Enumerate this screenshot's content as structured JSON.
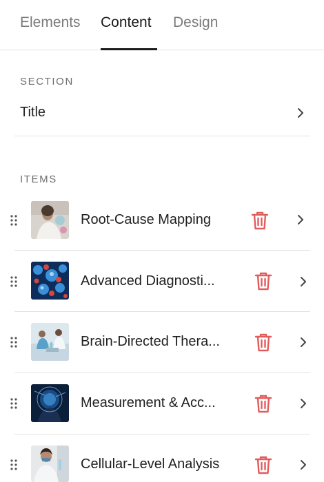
{
  "tabs": [
    {
      "label": "Elements",
      "active": false
    },
    {
      "label": "Content",
      "active": true
    },
    {
      "label": "Design",
      "active": false
    }
  ],
  "section": {
    "heading": "SECTION",
    "title_label": "Title"
  },
  "items_section": {
    "heading": "ITEMS",
    "items": [
      {
        "label": "Root-Cause Mapping",
        "thumbnail": "scientist-holding-petri-dish"
      },
      {
        "label": "Advanced Diagnosti...",
        "thumbnail": "blue-red-molecules"
      },
      {
        "label": "Brain-Directed Thera...",
        "thumbnail": "lab-researchers"
      },
      {
        "label": "Measurement & Acc...",
        "thumbnail": "digital-brain-interface"
      },
      {
        "label": "Cellular-Level Analysis",
        "thumbnail": "researcher-with-test-tube"
      }
    ]
  },
  "icons": {
    "chevron": "chevron-right-icon",
    "trash": "trash-icon",
    "drag": "drag-handle-icon"
  },
  "colors": {
    "text": "#1f1f1f",
    "muted": "#7a7a7a",
    "delete_red": "#e25c5c",
    "divider": "#e2e2e2"
  }
}
